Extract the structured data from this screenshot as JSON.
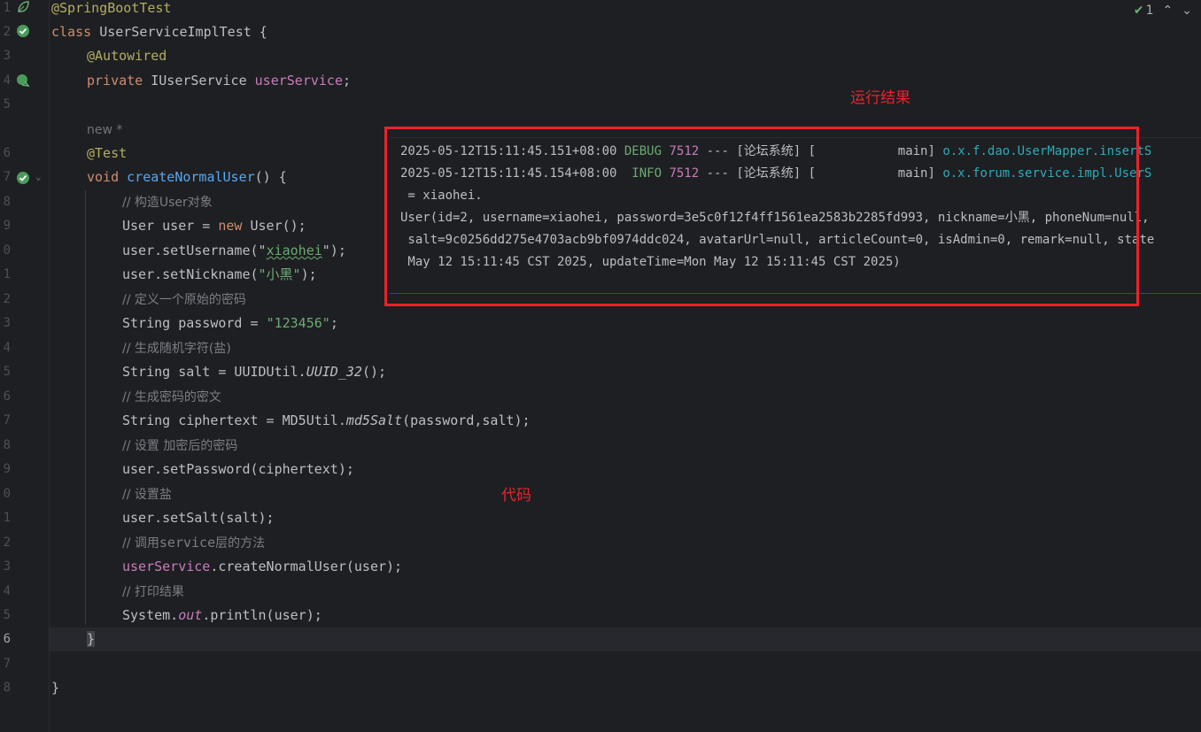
{
  "gutter": {
    "line_numbers": [
      "1",
      "2",
      "3",
      "4",
      "5",
      "",
      "6",
      "7",
      "8",
      "9",
      "0",
      "1",
      "2",
      "3",
      "4",
      "5",
      "6",
      "7",
      "8",
      "9",
      "0",
      "1",
      "2",
      "3",
      "4",
      "5",
      "6",
      "7",
      "8"
    ],
    "current_line": "6"
  },
  "top_right": {
    "check_count": "1"
  },
  "code": {
    "l1": "@SpringBootTest",
    "l2_kw": "class ",
    "l2_name": "UserServiceImplTest {",
    "l3": "@Autowired",
    "l4_kw": "private ",
    "l4_type": "IUserService ",
    "l4_field": "userService",
    "l4_end": ";",
    "hint": "new *",
    "l6": "@Test",
    "l7_kw": "void ",
    "l7_fn": "createNormalUser",
    "l7_end": "() {",
    "c1": "构造User对象",
    "l9_a": "User user = ",
    "l9_kw": "new ",
    "l9_b": "User();",
    "l10_a": "user.setUsername(\"",
    "l10_s": "xiaohei",
    "l10_b": "\");",
    "l11_a": "user.setNickname(",
    "l11_s": "\"小黑\"",
    "l11_b": ");",
    "c2": "定义一个原始的密码",
    "l13_a": "String password = ",
    "l13_s": "\"123456\"",
    "l13_b": ";",
    "c3": "生成随机字符(盐)",
    "l15_a": "String salt = UUIDUtil.",
    "l15_i": "UUID_32",
    "l15_b": "();",
    "c4": "生成密码的密文",
    "l17_a": "String ciphertext = MD5Util.",
    "l17_i": "md5Salt",
    "l17_b": "(password,salt);",
    "c5": "设置 加密后的密码",
    "l19": "user.setPassword(ciphertext);",
    "c6": "设置盐",
    "l21": "user.setSalt(salt);",
    "c7_pre": "调用",
    "c7_m": "service",
    "c7_post": "层的方法",
    "l23_f": "userService",
    "l23_b": ".createNormalUser(user);",
    "c8": "打印结果",
    "l25_a": "System.",
    "l25_i": "out",
    "l25_b": ".println(user);",
    "l26": "}",
    "l28": "}"
  },
  "console": {
    "r1_ts": "2025-05-12T15:11:45.151+08:00 ",
    "r1_level": "DEBUG",
    "r1_pid": "7512",
    "r1_mid": " --- [论坛系统] [           main] ",
    "r1_logger": "o.x.f.dao.UserMapper.insertS",
    "r2_ts": "2025-05-12T15:11:45.154+08:00  ",
    "r2_level": "INFO",
    "r2_pid": "7512",
    "r2_mid": " --- [论坛系统] [           main] ",
    "r2_logger": "o.x.forum.service.impl.UserS",
    "r3": " = xiaohei.",
    "r4": "User(id=2, username=xiaohei, password=3e5c0f12f4ff1561ea2583b2285fd993, nickname=小黑, phoneNum=null,",
    "r5": " salt=9c0256dd275e4703acb9bf0974ddc024, avatarUrl=null, articleCount=0, isAdmin=0, remark=null, state",
    "r6": " May 12 15:11:45 CST 2025, updateTime=Mon May 12 15:11:45 CST 2025)"
  },
  "annotations": {
    "result_label": "运行结果",
    "code_label": "代码"
  },
  "colors": {
    "annotation_red": "#e8232b",
    "background": "#1e1f22"
  }
}
